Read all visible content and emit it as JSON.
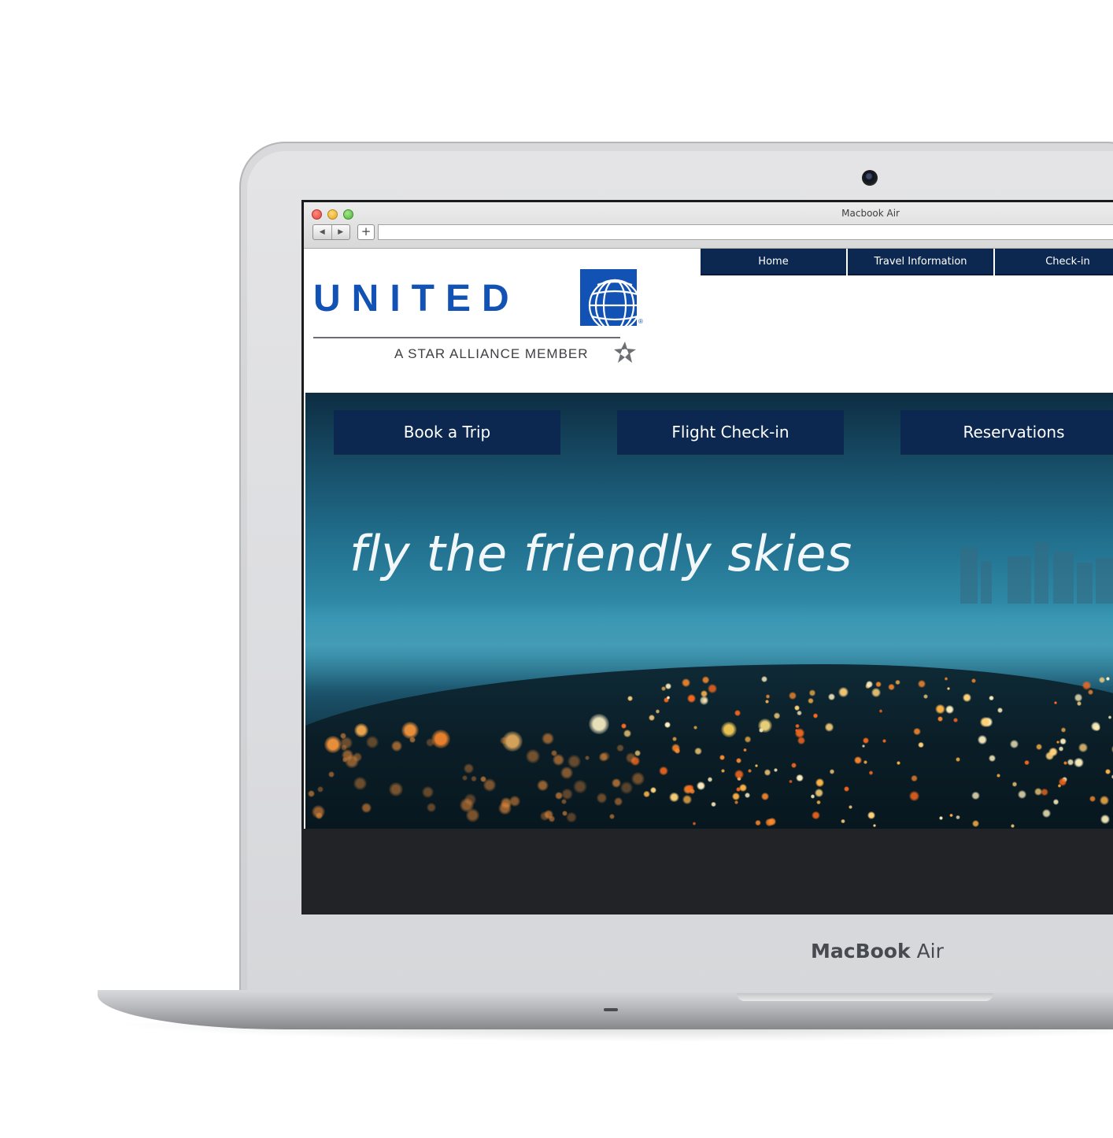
{
  "device": {
    "brand_bold": "MacBook",
    "brand_light": "Air"
  },
  "browser": {
    "window_title": "Macbook Air",
    "back_glyph": "◀",
    "forward_glyph": "▶",
    "new_tab_glyph": "+",
    "url": ""
  },
  "site": {
    "logo": {
      "wordmark": "UNITED",
      "registered": "®",
      "tagline": "A STAR ALLIANCE MEMBER"
    },
    "top_nav": [
      "Home",
      "Travel Information",
      "Check-in"
    ],
    "hero": {
      "actions": [
        "Book a Trip",
        "Flight Check-in",
        "Reservations"
      ],
      "headline": "fly the friendly skies"
    }
  },
  "colors": {
    "brand_blue": "#1152b4",
    "nav_navy": "#0c2850",
    "footer": "#222326"
  },
  "icons": [
    "globe-logo-icon",
    "star-alliance-icon",
    "camera-icon"
  ]
}
